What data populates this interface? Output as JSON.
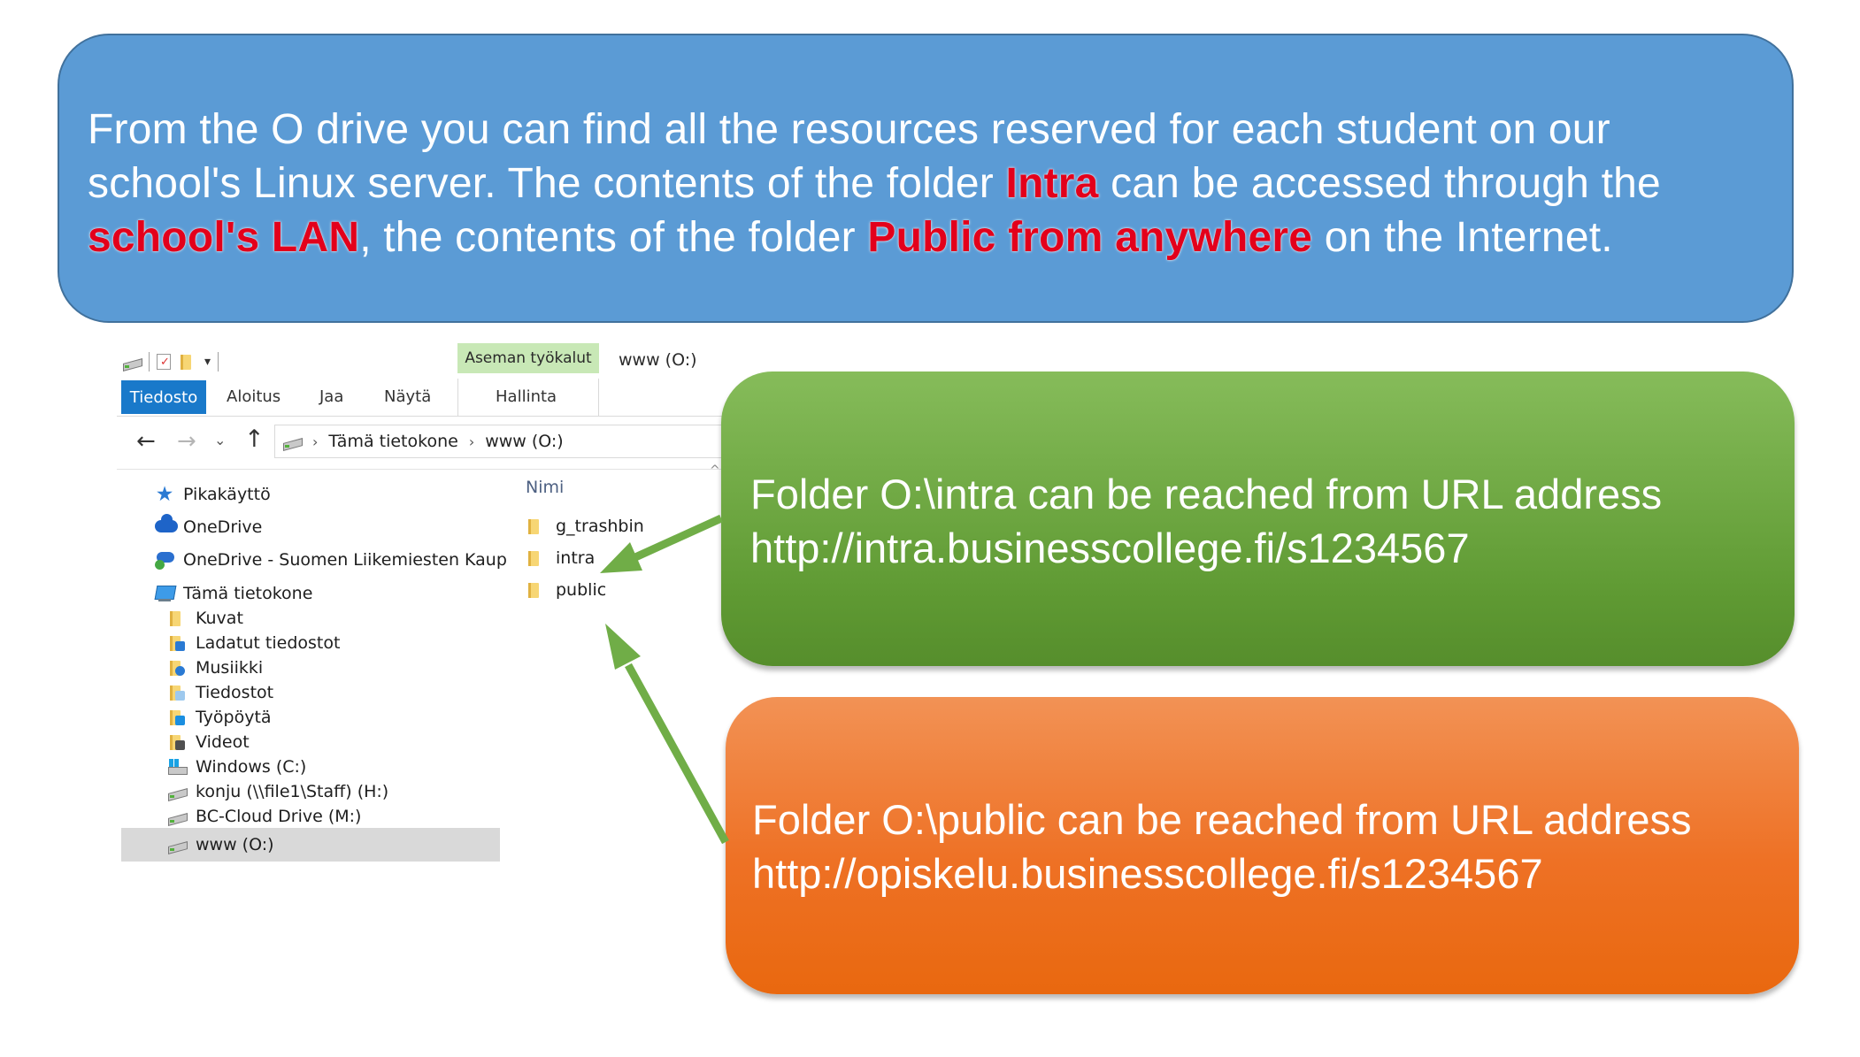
{
  "intro": {
    "p1": "From the O drive you can find all the resources reserved for each student on our school's Linux server. The contents of the folder ",
    "hl1": "Intra",
    "p2": " can be accessed through the ",
    "hl2": "school's LAN",
    "p3": ", the contents of the folder ",
    "hl3": "Public from anywhere",
    "p4": " on the Internet."
  },
  "intra_note": {
    "line1": "Folder O:\\intra can be reached from URL address",
    "line2": "http://intra.businesscollege.fi/s1234567"
  },
  "public_note": {
    "line1": "Folder O:\\public can be reached from URL address",
    "line2": "http://opiskelu.businesscollege.fi/s1234567"
  },
  "explorer": {
    "drive_tools_label": "Aseman työkalut",
    "window_title": "www (O:)",
    "tabs": {
      "file": "Tiedosto",
      "home": "Aloitus",
      "share": "Jaa",
      "view": "Näytä",
      "manage": "Hallinta"
    },
    "breadcrumb": [
      "Tämä tietokone",
      "www (O:)"
    ],
    "column_name": "Nimi",
    "nav": {
      "quick_access": "Pikakäyttö",
      "onedrive": "OneDrive",
      "onedrive_org": "OneDrive - Suomen Liikemiesten Kaup",
      "this_pc": "Tämä tietokone",
      "pictures": "Kuvat",
      "downloads": "Ladatut tiedostot",
      "music": "Musiikki",
      "documents": "Tiedostot",
      "desktop": "Työpöytä",
      "videos": "Videot",
      "drive_c": "Windows (C:)",
      "drive_h": "konju (\\\\file1\\Staff) (H:)",
      "drive_m": "BC-Cloud Drive (M:)",
      "drive_o": "www (O:)"
    },
    "files": [
      "g_trashbin",
      "intra",
      "public"
    ]
  },
  "colors": {
    "top_callout": "#5b9bd5",
    "highlight": "#e3001b",
    "green_callout": "#70ad47",
    "orange_callout": "#ed7d31",
    "arrow": "#70ad47"
  }
}
